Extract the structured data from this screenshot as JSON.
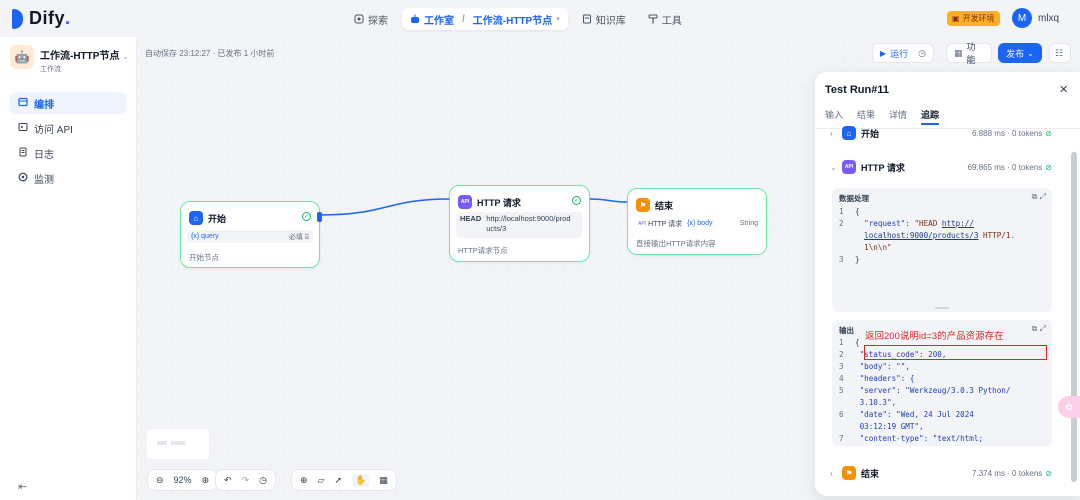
{
  "app": {
    "logo": "Dify",
    "logo_dot": "."
  },
  "nav": {
    "explore": "探索",
    "studio": "工作室",
    "current": "工作流-HTTP节点",
    "knowledge": "知识库",
    "tools": "工具"
  },
  "env_badge": "开发环境",
  "user": {
    "initial": "M",
    "name": "mlxq"
  },
  "sidebar": {
    "app_name": "工作流-HTTP节点",
    "app_type": "工作流",
    "items": [
      {
        "label": "编排",
        "icon": "layout-icon",
        "active": true
      },
      {
        "label": "访问 API",
        "icon": "terminal-icon",
        "active": false
      },
      {
        "label": "日志",
        "icon": "file-list-icon",
        "active": false
      },
      {
        "label": "监测",
        "icon": "monitor-icon",
        "active": false
      }
    ]
  },
  "canvas": {
    "autosave": "自动保存 23:12:27 · 已发布 1 小时前",
    "run": "运行",
    "features": "功能",
    "publish": "发布",
    "zoom": "92%"
  },
  "nodes": {
    "start": {
      "title": "开始",
      "var_label": "{x} query",
      "var_required": "必填",
      "desc": "开始节点"
    },
    "http": {
      "title": "HTTP 请求",
      "method": "HEAD",
      "url_line1": "http://localhost:9000/prod",
      "url_line2": "ucts/3",
      "desc": "HTTP请求节点"
    },
    "end": {
      "title": "结束",
      "var_source": "HTTP 请求",
      "var_name": "{x} body",
      "var_type": "String",
      "desc": "直接输出HTTP请求内容"
    }
  },
  "panel": {
    "title": "Test Run#11",
    "tabs": [
      "输入",
      "结果",
      "详情",
      "追踪"
    ],
    "active_tab": "追踪",
    "sections": [
      {
        "name": "开始",
        "meta": "6.888 ms · 0 tokens"
      },
      {
        "name": "HTTP 请求",
        "meta": "69.865 ms · 0 tokens"
      },
      {
        "name": "结束",
        "meta": "7.374 ms · 0 tokens"
      }
    ],
    "data_label": "数据处理",
    "output_label": "输出",
    "annotation": "返回200说明id=3的产品资源存在"
  },
  "code_input": [
    {
      "n": "1",
      "t": "{"
    },
    {
      "n": "2",
      "key": "\"request\"",
      "sep": ": ",
      "str_a": "\"HEAD ",
      "url": "http://",
      "str_b": ""
    },
    {
      "n": "",
      "url": "localhost:9000/products/3",
      "str_b": " HTTP/1."
    },
    {
      "n": "",
      "str_b": "1\\n\\n\""
    },
    {
      "n": "3",
      "t": "}"
    }
  ],
  "code_output": [
    {
      "n": "1",
      "t": "{"
    },
    {
      "n": "2",
      "t": "  \"status_code\": 200,"
    },
    {
      "n": "3",
      "t": "  \"body\": \"\","
    },
    {
      "n": "4",
      "t": "  \"headers\": {"
    },
    {
      "n": "5",
      "t": "    \"server\": \"Werkzeug/3.0.3 Python/"
    },
    {
      "n": "",
      "t": "    3.10.3\","
    },
    {
      "n": "6",
      "t": "    \"date\": \"Wed, 24 Jul 2024"
    },
    {
      "n": "",
      "t": "    03:12:19 GMT\","
    },
    {
      "n": "7",
      "t": "    \"content-type\": \"text/html;"
    }
  ],
  "colors": {
    "accent": "#1c64f2",
    "success": "#12b76a",
    "annotation": "#e02424"
  }
}
